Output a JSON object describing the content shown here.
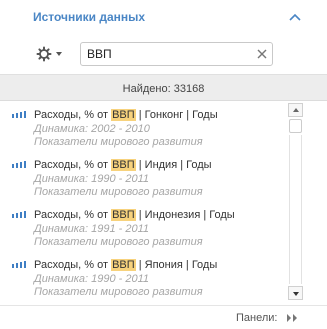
{
  "header": {
    "title": "Источники данных",
    "collapse_icon": "chevron-up-icon",
    "accent_color": "#4a86c5"
  },
  "toolbar": {
    "settings_icon": "gear-icon",
    "dropdown_icon": "caret-down-icon",
    "search": {
      "value": "ВВП",
      "clear_icon": "close-icon"
    }
  },
  "results": {
    "found_text": "Найдено: 33168",
    "highlight_color": "#f7d27c",
    "items": [
      {
        "title_prefix": "Расходы, % от ",
        "title_match": "ВВП",
        "title_suffix": " | Гонконг | Годы",
        "period": "Динамика: 2002 - 2010",
        "source": "Показатели мирового развития",
        "icon": "bar-chart-icon"
      },
      {
        "title_prefix": "Расходы, % от ",
        "title_match": "ВВП",
        "title_suffix": " | Индия | Годы",
        "period": "Динамика: 1990 - 2011",
        "source": "Показатели мирового развития",
        "icon": "bar-chart-icon"
      },
      {
        "title_prefix": "Расходы, % от ",
        "title_match": "ВВП",
        "title_suffix": " | Индонезия | Годы",
        "period": "Динамика: 1991 - 2011",
        "source": "Показатели мирового развития",
        "icon": "bar-chart-icon"
      },
      {
        "title_prefix": "Расходы, % от ",
        "title_match": "ВВП",
        "title_suffix": " | Япония | Годы",
        "period": "Динамика: 1990 - 2011",
        "source": "Показатели мирового развития",
        "icon": "bar-chart-icon"
      }
    ]
  },
  "footer": {
    "panels_label": "Панели:",
    "panels_icon": "double-chevron-right-icon"
  }
}
